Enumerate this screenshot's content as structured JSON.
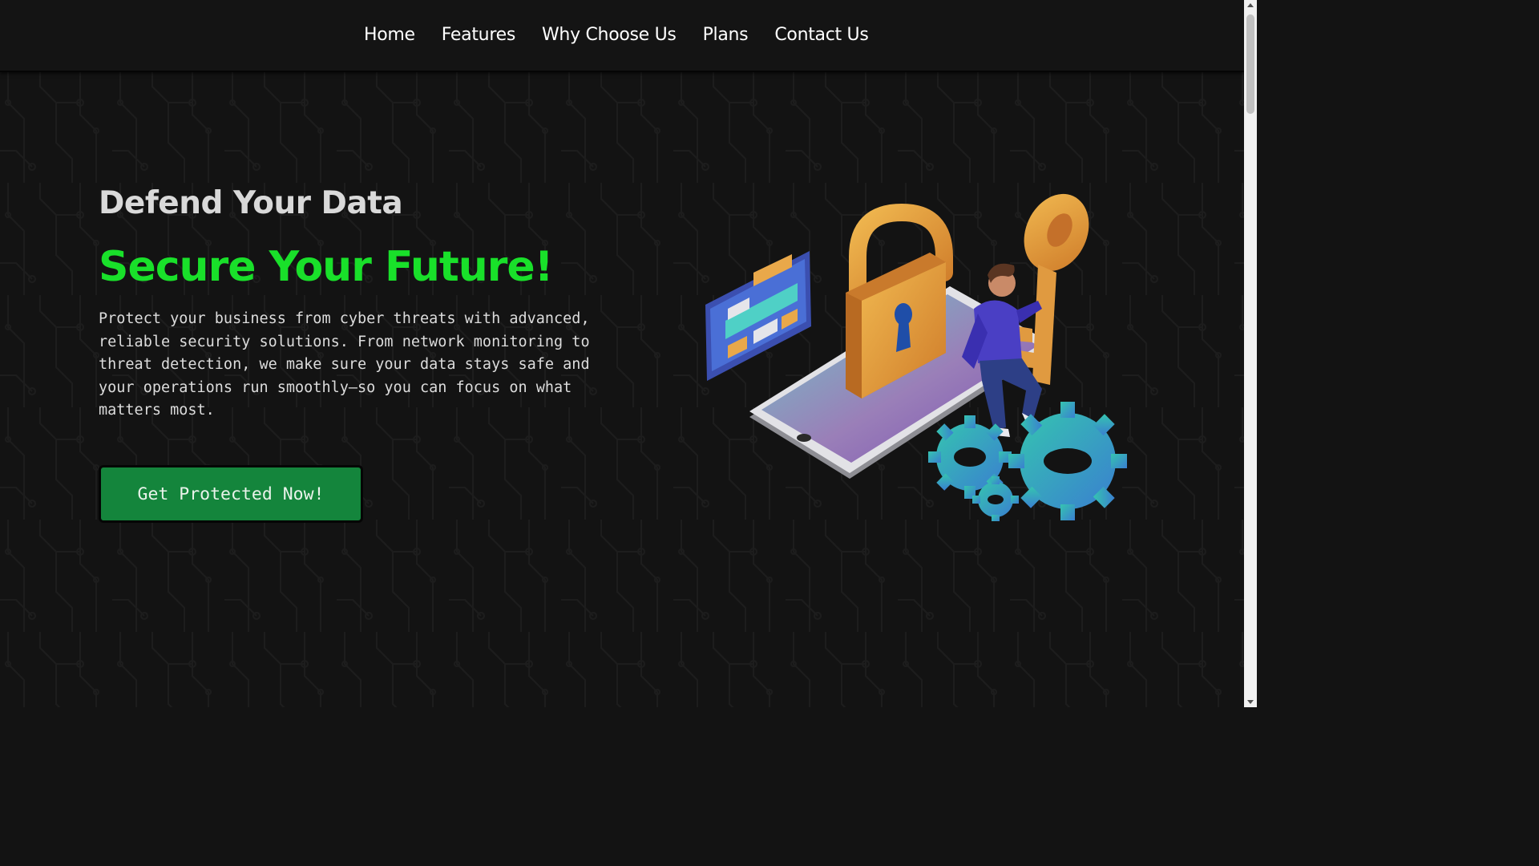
{
  "nav": {
    "links": [
      {
        "label": "Home"
      },
      {
        "label": "Features"
      },
      {
        "label": "Why Choose Us"
      },
      {
        "label": "Plans"
      },
      {
        "label": "Contact Us"
      }
    ]
  },
  "hero": {
    "title": "Defend Your Data",
    "subtitle": "Secure Your Future!",
    "description": "Protect your business from cyber threats with advanced, reliable security solutions. From network monitoring to threat detection, we make sure your data stays safe and your operations run smoothly—so you can focus on what matters most.",
    "cta_label": "Get Protected Now!"
  },
  "colors": {
    "background": "#131313",
    "accent_green": "#19e02a",
    "button_green": "#14853c",
    "lock_gold": "#e2a03c",
    "gear_teal": "#2fb7a8"
  },
  "icons": {
    "illustration": "security-lock-phone-illustration"
  }
}
